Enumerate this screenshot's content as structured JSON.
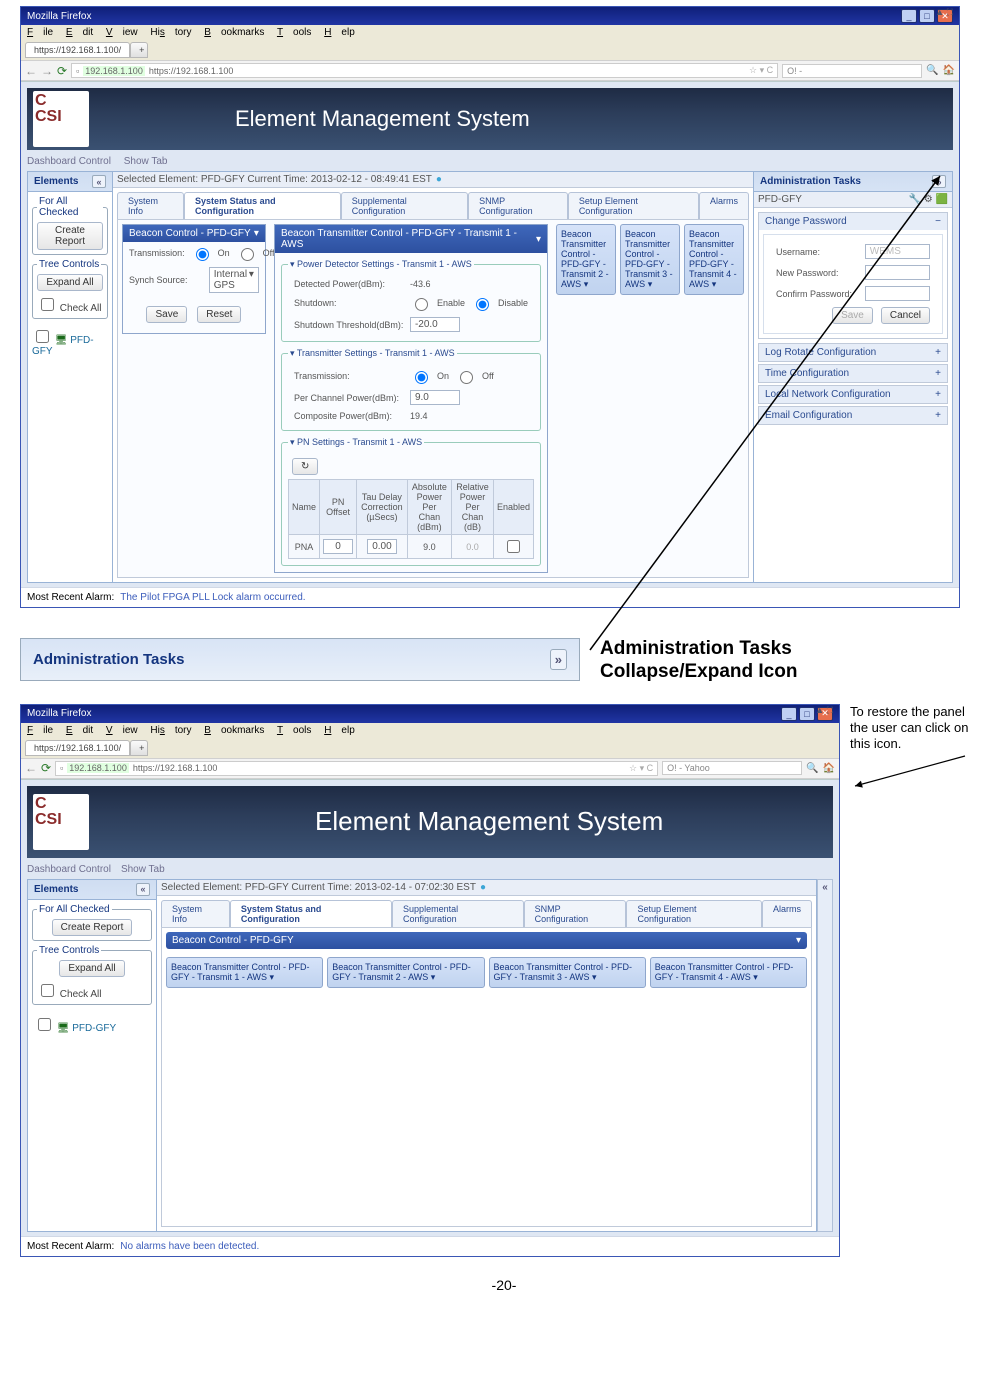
{
  "page_number": "-20-",
  "shot1": {
    "titlebar": "Mozilla Firefox",
    "menu": [
      "File",
      "Edit",
      "View",
      "History",
      "Bookmarks",
      "Tools",
      "Help"
    ],
    "tab_url": "https://192.168.1.100/",
    "addr_host": "192.168.1.100",
    "addr_full": "https://192.168.1.100",
    "search_engine": "O! -",
    "banner_title": "Element Management System",
    "dash_items": [
      "Dashboard Control",
      "Show Tab"
    ],
    "elements": {
      "title": "Elements",
      "for_all_checked": "For All Checked",
      "create_report": "Create Report",
      "tree_controls": "Tree Controls",
      "expand_all": "Expand All",
      "check_all": "Check All",
      "tree_node": "PFD-GFY"
    },
    "selected": "Selected Element:  PFD-GFY  Current Time: 2013-02-12 - 08:49:41 EST",
    "tabs": [
      "System Info",
      "System Status and Configuration",
      "Supplemental Configuration",
      "SNMP Configuration",
      "Setup Element Configuration",
      "Alarms"
    ],
    "beacon_ctrl": {
      "title": "Beacon Control - PFD-GFY",
      "transmission_lbl": "Transmission:",
      "opt_on": "On",
      "opt_off": "Off",
      "synch_lbl": "Synch Source:",
      "synch_val": "Internal GPS",
      "save": "Save",
      "reset": "Reset"
    },
    "tx_ctrl": {
      "title": "Beacon Transmitter Control - PFD-GFY - Transmit 1 - AWS",
      "pd_legend": "Power Detector Settings - Transmit 1 - AWS",
      "det_power_lbl": "Detected Power(dBm):",
      "det_power_val": "-43.6",
      "shutdown_lbl": "Shutdown:",
      "enable": "Enable",
      "disable": "Disable",
      "thresh_lbl": "Shutdown Threshold(dBm):",
      "thresh_val": "-20.0",
      "ts_legend": "Transmitter Settings - Transmit 1 - AWS",
      "pc_power_lbl": "Per Channel Power(dBm):",
      "pc_power_val": "9.0",
      "comp_power_lbl": "Composite Power(dBm):",
      "comp_power_val": "19.4",
      "pn_legend": "PN Settings - Transmit 1 - AWS",
      "tbl_headers": [
        "Name",
        "PN Offset",
        "Tau Delay Correction (µSecs)",
        "Absolute Power Per Chan (dBm)",
        "Relative Power Per Chan (dB)",
        "Enabled"
      ],
      "row": {
        "name": "PNA",
        "offset": "0",
        "tau": "0.00",
        "abs": "9.0",
        "rel": "0.0"
      }
    },
    "right_pills": [
      "Beacon Transmitter Control - PFD-GFY - Transmit 2 - AWS",
      "Beacon Transmitter Control - PFD-GFY - Transmit 3 - AWS",
      "Beacon Transmitter Control - PFD-GFY - Transmit 4 - AWS"
    ],
    "admin": {
      "title": "Administration Tasks",
      "node": "PFD-GFY",
      "chg_pwd": "Change Password",
      "user_lbl": "Username:",
      "user_val": "WEMS",
      "newpwd_lbl": "New Password:",
      "confpwd_lbl": "Confirm Password:",
      "save": "Save",
      "cancel": "Cancel",
      "items": [
        "Log Rotate Configuration",
        "Time Configuration",
        "Local Network Configuration",
        "Email Configuration"
      ]
    },
    "footer_lbl": "Most Recent Alarm:",
    "footer_msg": "The Pilot FPGA PLL Lock alarm occurred."
  },
  "annot": {
    "admin_header": "Administration Tasks",
    "chev": "»",
    "text_line1": "Administration Tasks",
    "text_line2": "Collapse/Expand Icon"
  },
  "shot2": {
    "note": "To restore the panel the user can click on this icon.",
    "titlebar": "Mozilla Firefox",
    "tab_url": "https://192.168.1.100/",
    "addr_host": "192.168.1.100",
    "addr_full": "https://192.168.1.100",
    "search_engine": "O! - Yahoo",
    "banner_title": "Element Management System",
    "selected": "Selected Element:  PFD-GFY  Current Time: 2013-02-14 - 07:02:30 EST",
    "beacon_h": "Beacon Control - PFD-GFY",
    "pills": [
      "Beacon Transmitter Control - PFD-GFY - Transmit 1 - AWS",
      "Beacon Transmitter Control - PFD-GFY - Transmit 2 - AWS",
      "Beacon Transmitter Control - PFD-GFY - Transmit 3 - AWS",
      "Beacon Transmitter Control - PFD-GFY - Transmit 4 - AWS"
    ],
    "footer_lbl": "Most Recent Alarm:",
    "footer_msg": "No alarms have been detected.",
    "collapse_glyph": "«"
  }
}
